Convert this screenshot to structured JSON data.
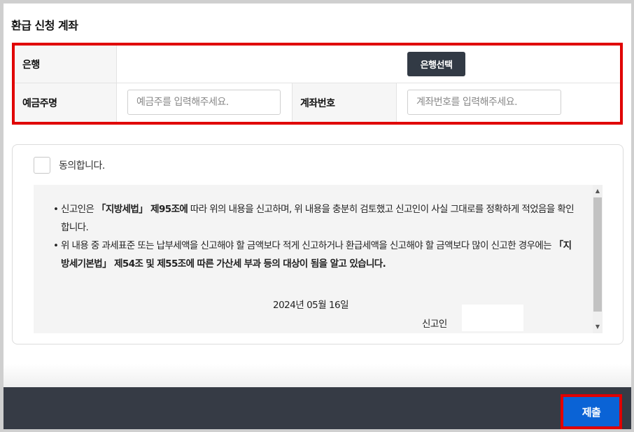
{
  "section_title": "환급 신청 계좌",
  "account": {
    "bank_label": "은행",
    "bank_button": "은행선택",
    "holder_label": "예금주명",
    "holder_placeholder": "예금주를 입력해주세요.",
    "number_label": "계좌번호",
    "number_placeholder": "계좌번호를 입력해주세요."
  },
  "consent": {
    "agree_label": "동의합니다.",
    "notice": {
      "b1_pre": "신고인은 ",
      "b1_bold1": "「지방세법」 제95조에",
      "b1_post": " 따라 위의 내용을 신고하며, 위 내용을 충분히 검토했고 신고인이 사실 그대로를 정확하게 적었음을 확인합니다.",
      "b2_pre": "위 내용 중 과세표준 또는 납부세액을 신고해야 할 금액보다 적게 신고하거나 환급세액을 신고해야 할 금액보다 많이 신고한 경우에는 ",
      "b2_bold": "「지방세기본법」 제54조 및 제55조에 따른 가산세 부과 등의 대상이 됨을 알고 있습니다."
    },
    "date": "2024년 05월 16일",
    "reporter_label": "신고인"
  },
  "footer": {
    "submit_label": "제출"
  },
  "colors": {
    "highlight_border": "#e00000",
    "bank_button_bg": "#323a45",
    "submit_bg": "#0a63d6",
    "footer_bg": "#363b45"
  }
}
